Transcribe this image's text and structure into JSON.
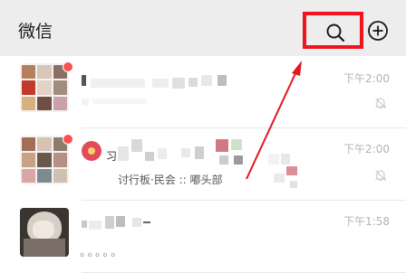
{
  "header": {
    "title": "微信",
    "icons": {
      "search": "search-icon",
      "add": "plus-circle-icon"
    },
    "highlight_color": "#f0141e"
  },
  "chats": [
    {
      "time": "下午2:00",
      "muted": true,
      "unread_dot": true
    },
    {
      "time": "下午2:00",
      "muted": true,
      "unread_dot": true,
      "name_fragment": "习",
      "preview_fragment": "讨行板·民会  :: 嘟头部"
    },
    {
      "time": "下午1:58",
      "muted": false,
      "unread_dot": false,
      "preview": "。。。。。"
    }
  ],
  "colors": {
    "header_bg": "#ededed",
    "badge": "#fa5151",
    "annotation": "#e5141f"
  }
}
